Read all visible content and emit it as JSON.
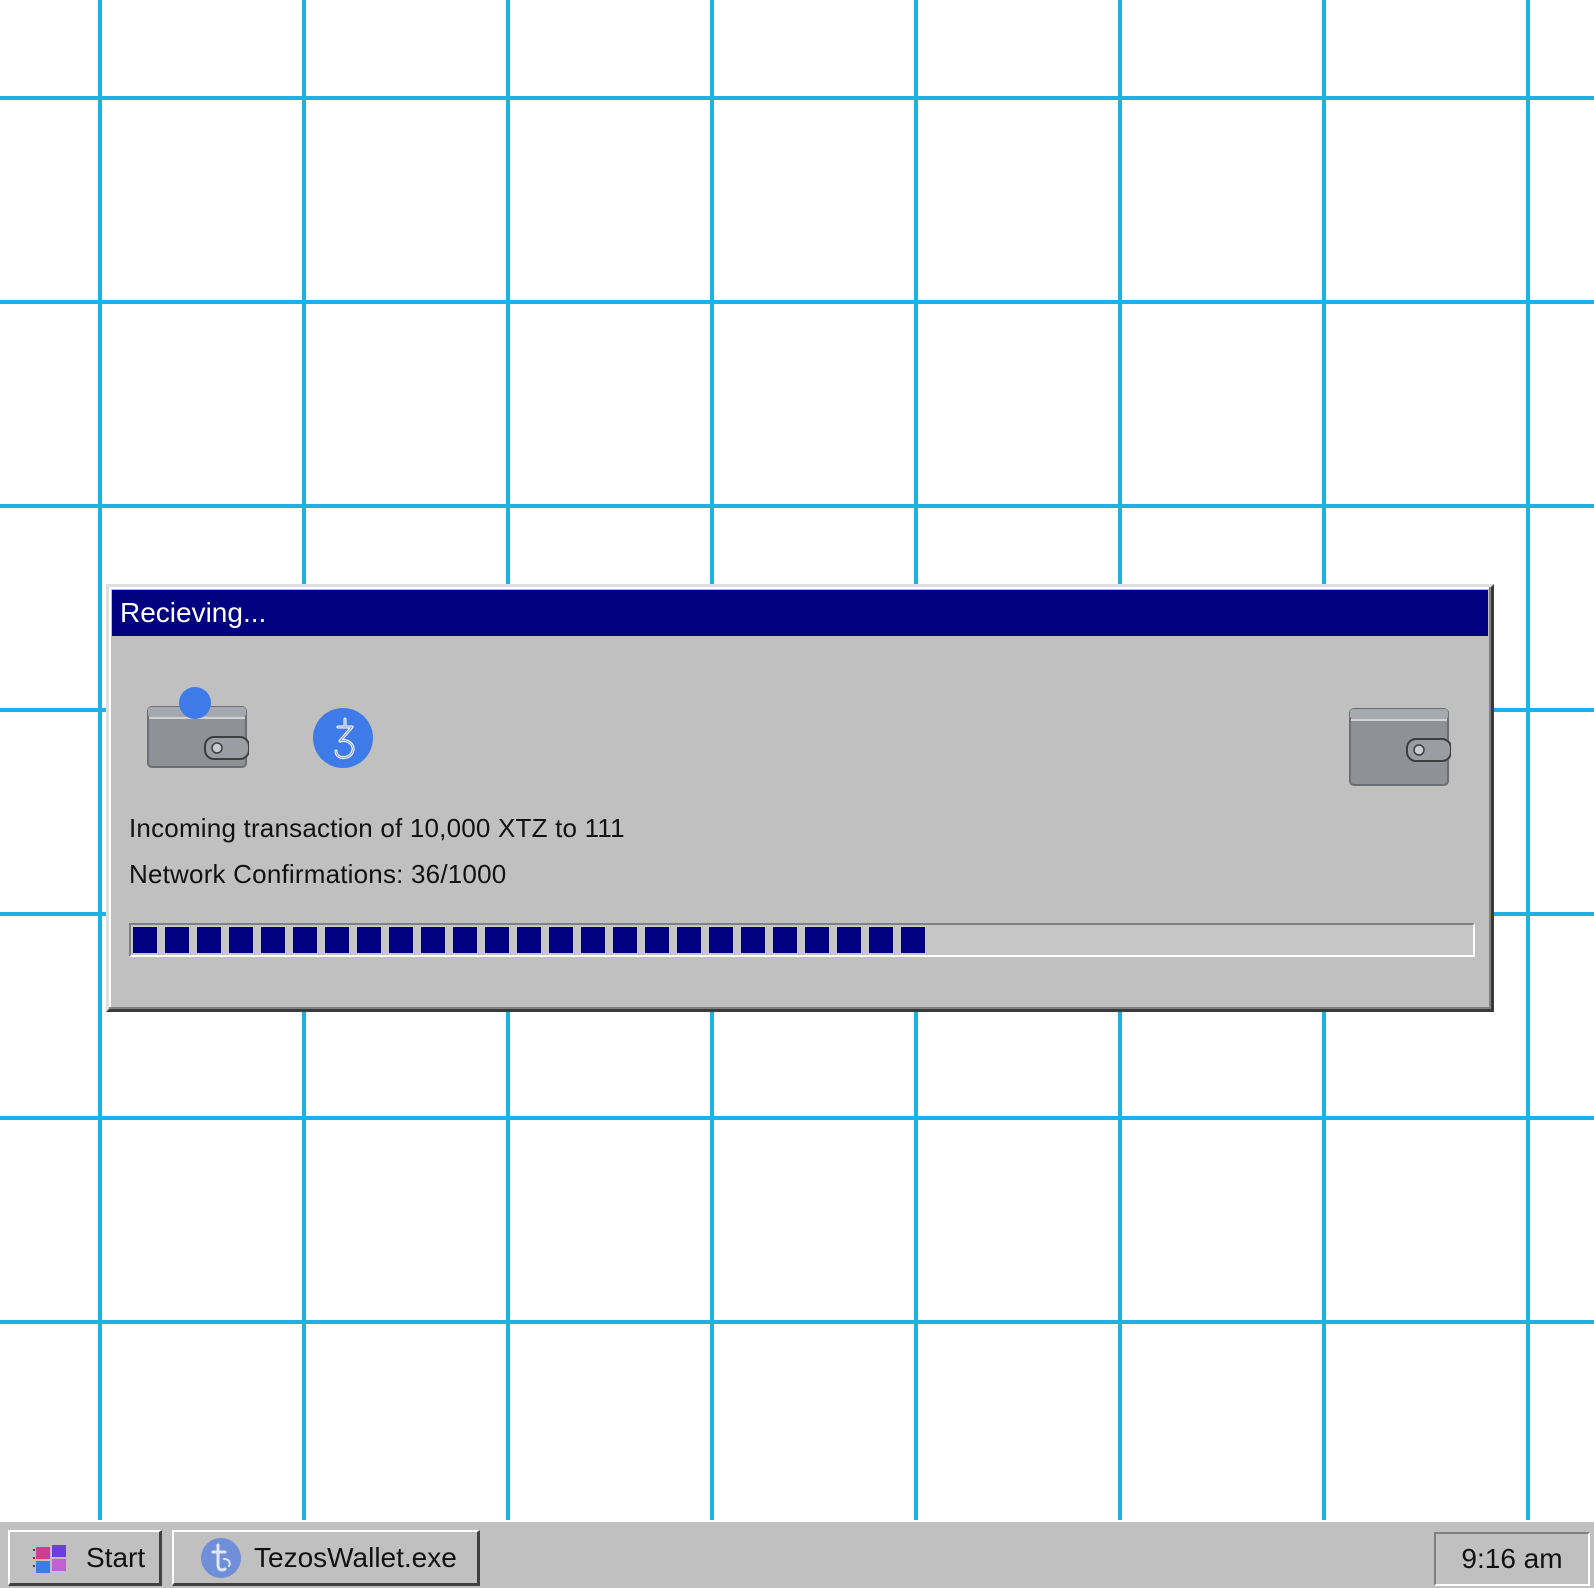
{
  "dialog": {
    "title": "Recieving...",
    "transaction_text": "Incoming transaction of 10,000 XTZ to 111",
    "confirmations_text": "Network Confirmations: 36/1000",
    "progress_fraction": 0.59,
    "sender_icon": "wallet-icon",
    "coin_icon": "tezos-coin-icon",
    "receiver_icon": "wallet-icon"
  },
  "taskbar": {
    "start_label": "Start",
    "app_label": "TezosWallet.exe",
    "clock": "9:16 am"
  },
  "colors": {
    "desktop_background": "#ffffff",
    "grid_lines": "#1eb1e6",
    "title_bar": "#000080",
    "window_face": "#c0c0c0",
    "progress_block": "#000080",
    "coin": "#3f7be8"
  }
}
